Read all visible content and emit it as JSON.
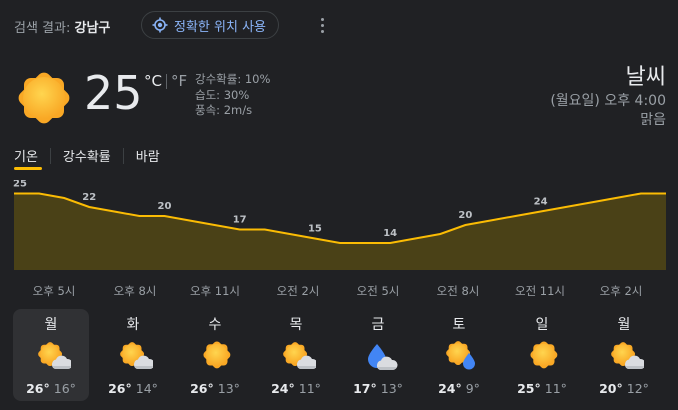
{
  "location": {
    "prefix": "검색 결과: ",
    "name": "강남구",
    "precise_button": "정확한 위치 사용"
  },
  "current": {
    "temperature": "25",
    "unit_c": "°C",
    "unit_f": "°F",
    "precipitation": "강수확률: 10%",
    "humidity": "습도: 30%",
    "wind": "풍속: 2m/s",
    "icon": "sun-icon"
  },
  "summary": {
    "title": "날씨",
    "datetime": "(월요일) 오후 4:00",
    "condition": "맑음"
  },
  "tabs": [
    {
      "label": "기온",
      "active": true
    },
    {
      "label": "강수확률",
      "active": false
    },
    {
      "label": "바람",
      "active": false
    }
  ],
  "chart_data": {
    "type": "area",
    "series": [
      {
        "values": [
          25,
          25,
          24,
          22,
          21,
          20,
          20,
          19,
          18,
          17,
          17,
          16,
          15,
          14,
          14,
          14,
          15,
          16,
          18,
          19,
          20,
          21,
          22,
          23,
          24,
          25,
          25
        ]
      }
    ],
    "data_labels": [
      {
        "index": 0,
        "text": "25"
      },
      {
        "index": 3,
        "text": "22"
      },
      {
        "index": 6,
        "text": "20"
      },
      {
        "index": 9,
        "text": "17"
      },
      {
        "index": 12,
        "text": "15"
      },
      {
        "index": 15,
        "text": "14"
      },
      {
        "index": 18,
        "text": "20"
      },
      {
        "index": 21,
        "text": "24"
      }
    ],
    "x_tick_labels": [
      "오후 5시",
      "오후 8시",
      "오후 11시",
      "오전 2시",
      "오전 5시",
      "오전 8시",
      "오전 11시",
      "오후 2시"
    ],
    "ylim": [
      8,
      28
    ],
    "line_color": "#fbbc04",
    "fill_color": "#4a4117"
  },
  "forecast": [
    {
      "day": "월",
      "high": "26°",
      "low": "16°",
      "icon": "sun-cloud-icon",
      "selected": true
    },
    {
      "day": "화",
      "high": "26°",
      "low": "14°",
      "icon": "sun-cloud-icon",
      "selected": false
    },
    {
      "day": "수",
      "high": "26°",
      "low": "13°",
      "icon": "sun-icon",
      "selected": false
    },
    {
      "day": "목",
      "high": "24°",
      "low": "11°",
      "icon": "sun-cloud-icon",
      "selected": false
    },
    {
      "day": "금",
      "high": "17°",
      "low": "13°",
      "icon": "rain-cloud-icon",
      "selected": false
    },
    {
      "day": "토",
      "high": "24°",
      "low": "9°",
      "icon": "sun-rain-icon",
      "selected": false
    },
    {
      "day": "일",
      "high": "25°",
      "low": "11°",
      "icon": "sun-icon",
      "selected": false
    },
    {
      "day": "월",
      "high": "20°",
      "low": "12°",
      "icon": "sun-cloud-icon",
      "selected": false
    }
  ]
}
